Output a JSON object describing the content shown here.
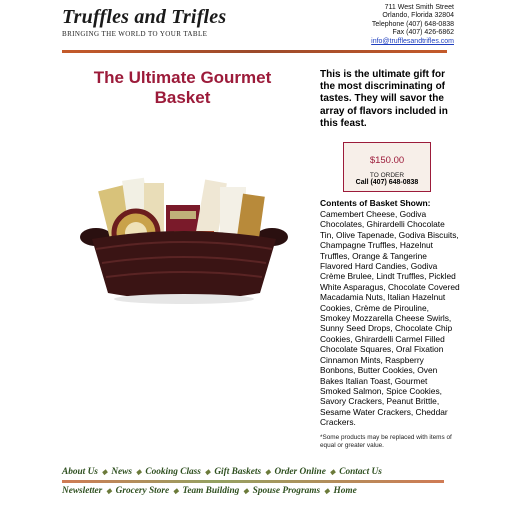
{
  "header": {
    "logo_text": "Truffles and Trifles",
    "tagline": "Bringing the World to your Table",
    "address": {
      "street": "711 West Smith Street",
      "city": "Orlando, Florida 32804",
      "telephone": "Telephone (407) 648-0838",
      "fax": "Fax (407) 426-6862",
      "email": "info@trufflesandtrifles.com"
    }
  },
  "product": {
    "title_line1": "The Ultimate Gourmet",
    "title_line2": "Basket",
    "intro": "This is the ultimate gift for the most discriminating of tastes. They will savor the array of flavors included in this feast.",
    "price": "$150.00",
    "order_label": "TO ORDER",
    "order_phone": "Call (407) 648-0838",
    "contents_heading": "Contents of Basket Shown:",
    "contents": "Camembert Cheese, Godiva Chocolates, Ghirardelli Chocolate Tin, Olive Tapenade, Godiva Biscuits, Champagne Truffles, Hazelnut Truffles, Orange & Tangerine Flavored Hard Candies, Godiva Crème Brulee, Lindt Truffles, Pickled White Asparagus, Chocolate Covered Macadamia Nuts, Italian Hazelnut Cookies, Crème de Pirouline, Smokey Mozzarella Cheese Swirls, Sunny Seed Drops, Chocolate Chip Cookies, Ghirardelli Carmel Filled Chocolate Squares, Oral Fixation Cinnamon Mints, Raspberry Bonbons, Butter Cookies, Oven Bakes Italian Toast, Gourmet Smoked Salmon, Spice Cookies, Savory Crackers, Peanut Brittle, Sesame Water Crackers, Cheddar Crackers.",
    "disclaimer": "*Some products may be replaced with items of equal or greater value."
  },
  "nav": {
    "row1": [
      "About Us",
      "News",
      "Cooking Class",
      "Gift Baskets",
      "Order Online",
      "Contact Us"
    ],
    "row2": [
      "Newsletter",
      "Grocery Store",
      "Team Building",
      "Spouse Programs",
      "Home"
    ]
  },
  "colors": {
    "title": "#9c1b3a",
    "nav": "#2f5020",
    "rule": "#c45a2a"
  }
}
